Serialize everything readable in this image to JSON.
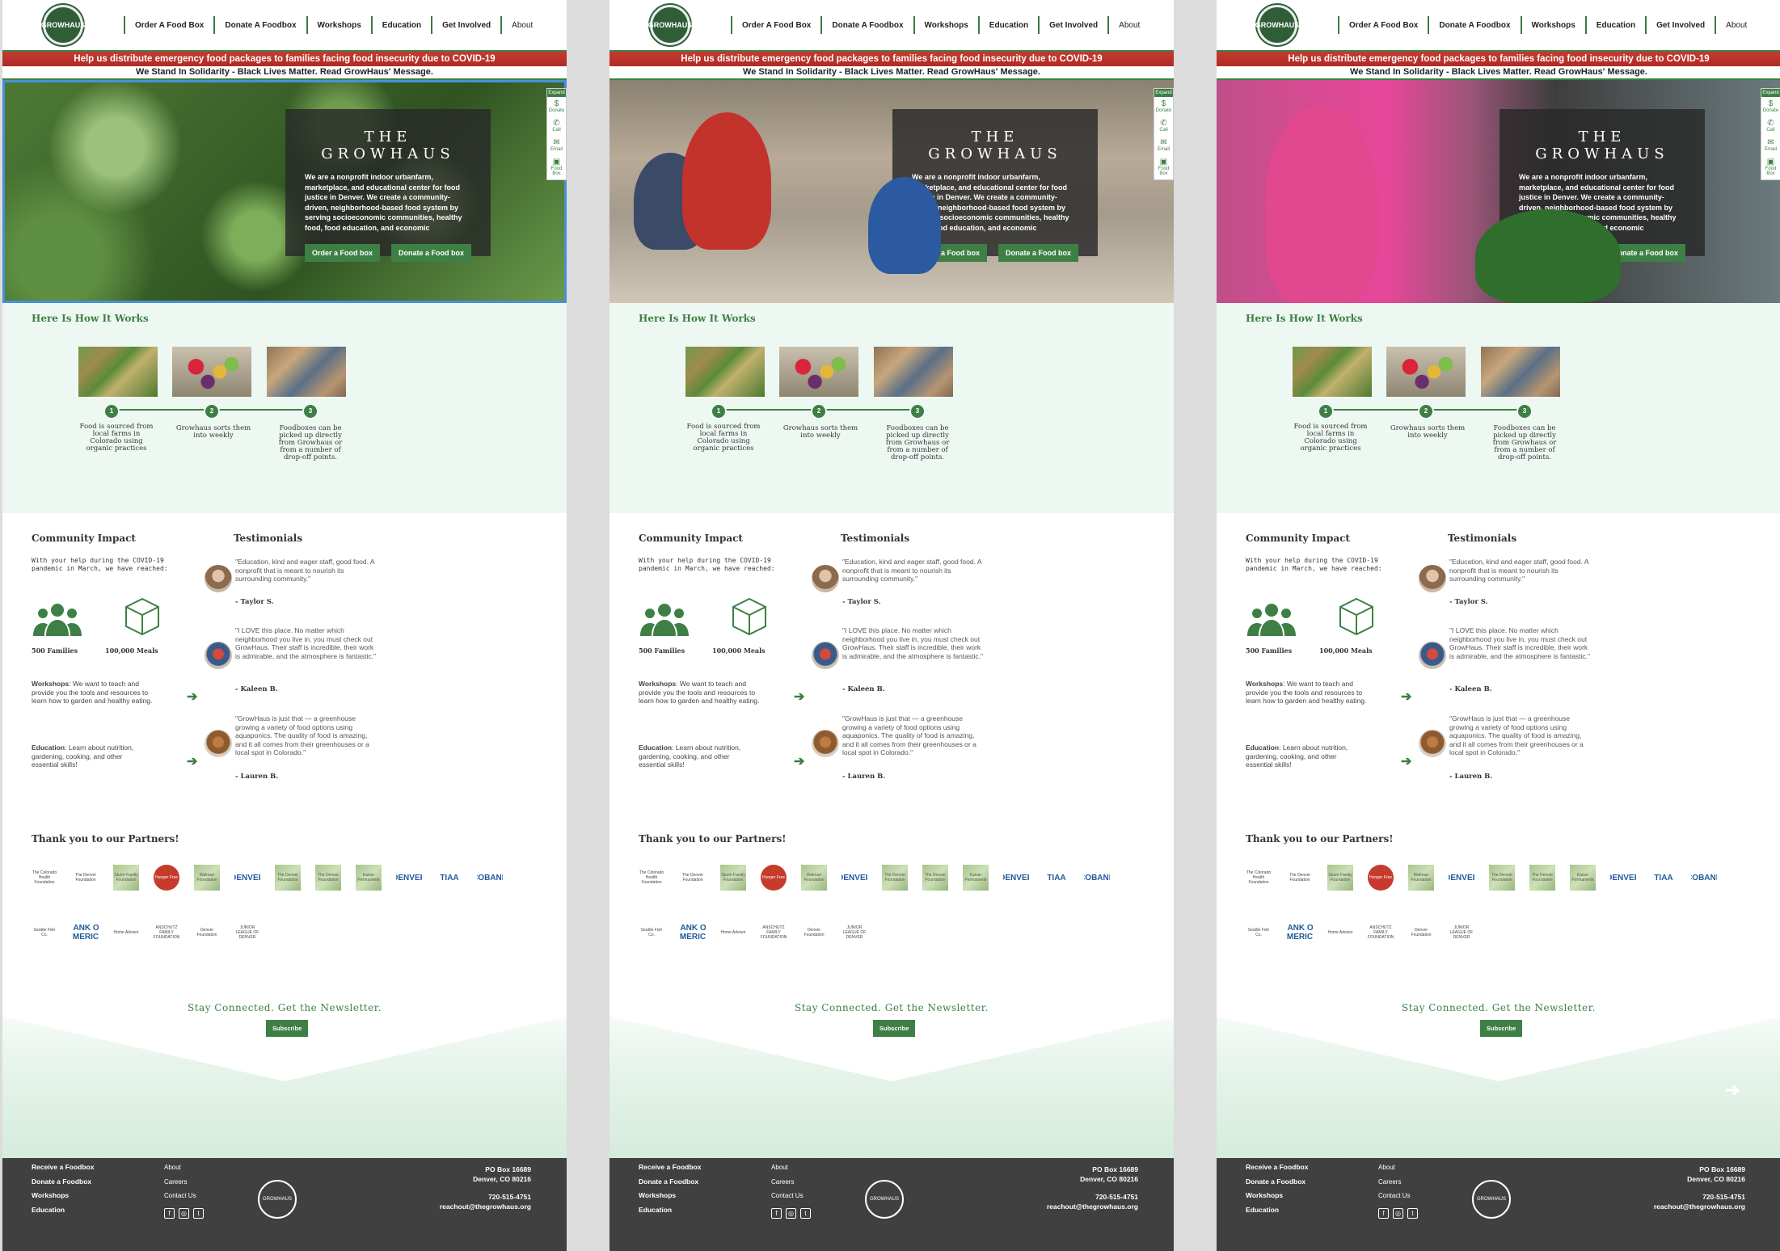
{
  "nav": {
    "logo_text": "GROWHAUS",
    "items": [
      "Order A Food Box",
      "Donate A Foodbox",
      "Workshops",
      "Education",
      "Get Involved",
      "About"
    ]
  },
  "banner": {
    "alert": "Help us distribute emergency food packages to families facing food insecurity due to COVID-19",
    "solidarity": "We Stand In Solidarity - Black Lives Matter. Read GrowHaus' Message."
  },
  "hero": {
    "title": "THE GROWHAUS",
    "text": "We are a nonprofit indoor urbanfarm, marketplace, and educational center for food justice in Denver. We create a community-driven, neighborhood-based food system by serving socioeconomic communities, healthy food, food education, and economic",
    "order_button": "Order a Food box",
    "donate_button": "Donate a Food box"
  },
  "side_widget": {
    "expand": "Expand",
    "items": [
      "Donate",
      "Call",
      "Email",
      "Food Box"
    ]
  },
  "how": {
    "title": "Here Is How It Works",
    "steps": [
      {
        "num": "1",
        "text": "Food is sourced from local farms in Colorado using organic practices"
      },
      {
        "num": "2",
        "text": "Growhaus sorts them into weekly"
      },
      {
        "num": "3",
        "text": "Foodboxes can be picked up directly from Growhaus or from a number of drop-off points."
      }
    ]
  },
  "impact": {
    "title": "Community Impact",
    "intro": "With your help during the COVID-19 pandemic in March, we have reached:",
    "families": "500 Families",
    "meals": "100,000 Meals",
    "workshops_label": "Workshops",
    "workshops_text": ": We want to teach and provide you the tools and resources to learn how to garden and healthy eating.",
    "education_label": "Education",
    "education_text": ": Learn about nutrition, gardening, cooking, and other essential skills!"
  },
  "testimonials": {
    "title": "Testimonials",
    "items": [
      {
        "quote": "\"Education, kind and eager staff, good food. A nonprofit that is meant to nourish its surrounding community.\"",
        "name": "- Taylor S."
      },
      {
        "quote": "\"I LOVE this place. No matter which neighborhood you live in, you must check out GrowHaus. Their staff is incredible, their work is admirable, and the atmosphere is fantastic.\"",
        "name": "- Kaleen B."
      },
      {
        "quote": "\"GrowHaus is just that — a greenhouse growing a variety of food options using aquaponics. The quality of food is amazing, and it all comes from their greenhouses or a local spot in Colorado.\"",
        "name": "- Lauren B."
      }
    ]
  },
  "partners": {
    "title": "Thank you to our Partners!",
    "logos": [
      "The Colorado Health Foundation",
      "The Denver Foundation",
      "Sturm Family Foundation",
      "Hunger Free",
      "Walmart Foundation",
      "DENVER",
      "The Denver Foundation",
      "The Denver Foundation",
      "Kaiser Permanente",
      "DENVER",
      "TIAA",
      "COBANK",
      "Seattle Fish Co.",
      "BANK OF AMERICA",
      "Home Advisor",
      "ANSCHUTZ FAMILY FOUNDATION",
      "Denver Foundation",
      "JUNIOR LEAGUE OF DENVER"
    ]
  },
  "newsletter": {
    "title": "Stay Connected. Get the Newsletter.",
    "button": "Subscribe"
  },
  "footer": {
    "links1": [
      "Receive a Foodbox",
      "Donate a Foodbox",
      "Workshops",
      "Education"
    ],
    "links2": [
      "About",
      "Careers",
      "Contact Us"
    ],
    "address1": "PO Box 16689",
    "address2": "Denver, CO 80216",
    "phone": "720-515-4751",
    "email": "reachout@thegrowhaus.org"
  },
  "colors": {
    "brand_green": "#3e7f45",
    "alert_red": "#c43a31",
    "footer_bg": "#404040",
    "section_bg": "#eef8f2"
  }
}
